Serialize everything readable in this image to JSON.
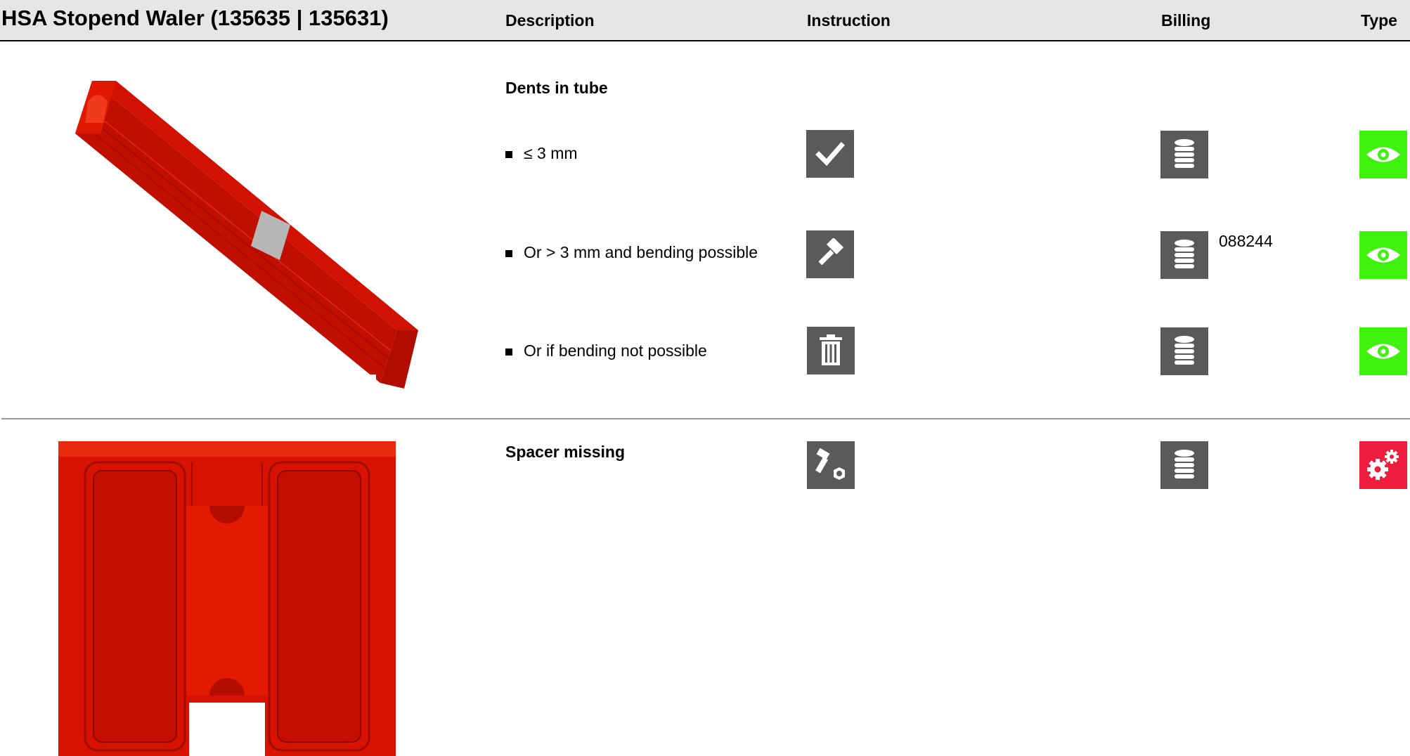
{
  "header": {
    "title": "HSA Stopend Waler (135635 | 135631)",
    "columns": {
      "description": "Description",
      "instruction": "Instruction",
      "billing": "Billing",
      "type": "Type"
    }
  },
  "sections": [
    {
      "title": "Dents in tube",
      "items": [
        {
          "label": "≤ 3 mm",
          "instruction_icon": "checkmark-icon",
          "billing_icon": "coin-stack-icon",
          "billing_code": "",
          "type_icon": "eye-icon",
          "type_color": "#3ef20e"
        },
        {
          "label": "Or > 3 mm and bending possible",
          "instruction_icon": "hammer-icon",
          "billing_icon": "coin-stack-icon",
          "billing_code": "088244",
          "type_icon": "eye-icon",
          "type_color": "#3ef20e"
        },
        {
          "label": "Or if bending not possible",
          "instruction_icon": "trash-icon",
          "billing_icon": "coin-stack-icon",
          "billing_code": "",
          "type_icon": "eye-icon",
          "type_color": "#3ef20e"
        }
      ]
    },
    {
      "title": "Spacer missing",
      "items": [
        {
          "label": "",
          "instruction_icon": "bolt-nut-icon",
          "billing_icon": "coin-stack-icon",
          "billing_code": "",
          "type_icon": "gears-icon",
          "type_color": "#ee1d3d"
        }
      ]
    }
  ],
  "colors": {
    "header_bg": "#e6e6e6",
    "icon_dark": "#5a5a5a",
    "type_ok": "#3ef20e",
    "type_repair": "#ee1d3d",
    "product_red": "#cc0e00"
  }
}
